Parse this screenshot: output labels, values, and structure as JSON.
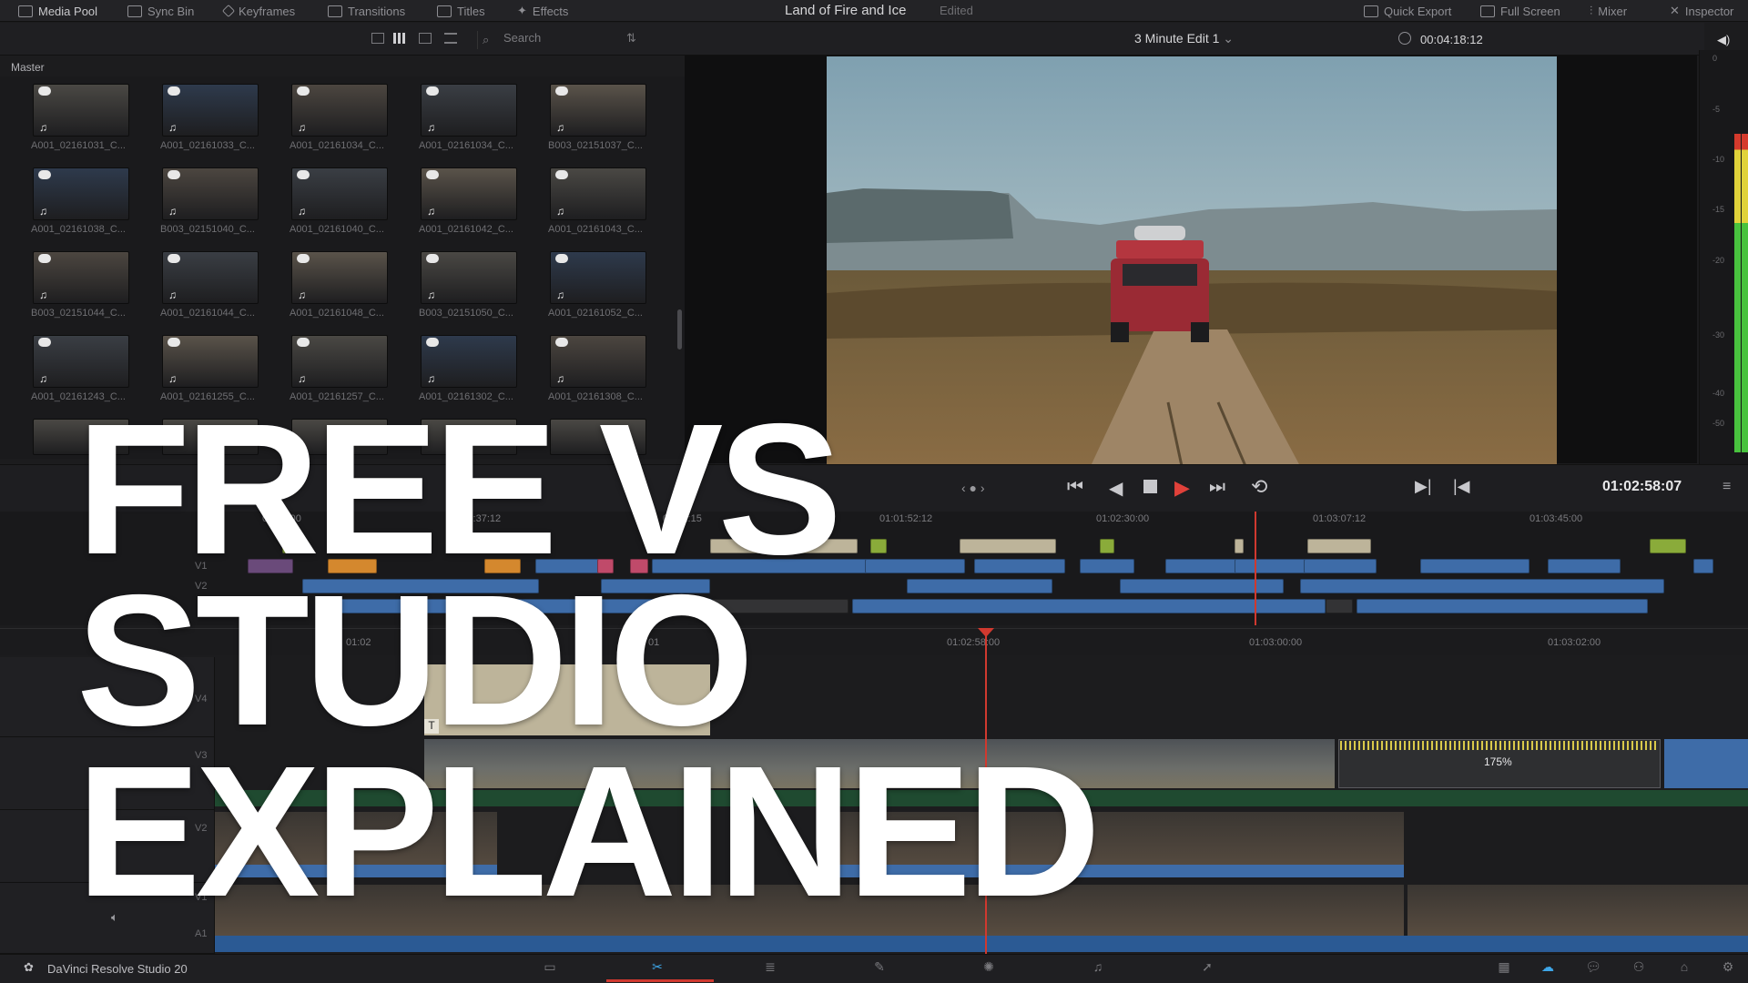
{
  "topbar": {
    "media_pool": "Media Pool",
    "sync_bin": "Sync Bin",
    "keyframes": "Keyframes",
    "transitions": "Transitions",
    "titles": "Titles",
    "effects": "Effects",
    "project_title": "Land of Fire and Ice",
    "project_status": "Edited",
    "quick_export": "Quick Export",
    "full_screen": "Full Screen",
    "mixer": "Mixer",
    "inspector": "Inspector"
  },
  "media_pool": {
    "search_placeholder": "Search",
    "bin": "Master",
    "clips": [
      "A001_02161031_C...",
      "A001_02161033_C...",
      "A001_02161034_C...",
      "A001_02161034_C...",
      "B003_02151037_C...",
      "A001_02161038_C...",
      "B003_02151040_C...",
      "A001_02161040_C...",
      "A001_02161042_C...",
      "A001_02161043_C...",
      "B003_02151044_C...",
      "A001_02161044_C...",
      "A001_02161048_C...",
      "B003_02151050_C...",
      "A001_02161052_C...",
      "A001_02161243_C...",
      "A001_02161255_C...",
      "A001_02161257_C...",
      "A001_02161302_C...",
      "A001_02161308_C..."
    ]
  },
  "viewer": {
    "timeline_name": "3 Minute Edit 1",
    "source_timecode": "00:04:18:12",
    "record_timecode": "01:02:58:07"
  },
  "meter": {
    "scale": [
      "0",
      "-5",
      "-10",
      "-15",
      "-20",
      "-30",
      "-40",
      "-50"
    ]
  },
  "mini_timeline": {
    "ruler": [
      "01:00:00",
      "01:00:37:12",
      "01:01:15",
      "01:01:52:12",
      "01:02:30:00",
      "01:03:07:12",
      "01:03:45:00"
    ],
    "tracks": [
      "V1",
      "V2"
    ]
  },
  "timeline": {
    "ruler": [
      "01:02",
      "01",
      "01:02:58:00",
      "01:03:00:00",
      "01:03:02:00"
    ],
    "tracks": [
      "V4",
      "V3",
      "V2",
      "V1",
      "A1"
    ],
    "speed_label": "175%",
    "title_marker": "T"
  },
  "app": {
    "name": "DaVinci Resolve Studio 20"
  },
  "overlay": {
    "line1": "FREE VS",
    "line2": "STUDIO",
    "line3": "EXPLAINED"
  },
  "colors": {
    "playhead": "#d0392f",
    "clip_blue": "#3e6ca8",
    "clip_beige": "#bdb49a",
    "clip_green": "#8aab3a",
    "clip_orange": "#d4882e",
    "clip_pink": "#c04a6a"
  }
}
